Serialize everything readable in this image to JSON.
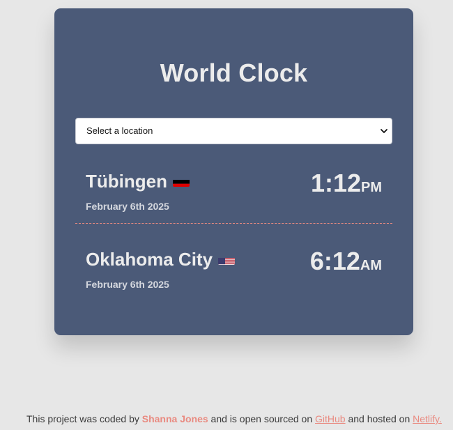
{
  "app": {
    "title": "World Clock"
  },
  "location_select": {
    "selected": "Select a location"
  },
  "cities": [
    {
      "name": "Tübingen",
      "flag_icon": "germany-flag-icon",
      "date": "February 6th 2025",
      "time": "1:12",
      "ampm": "PM"
    },
    {
      "name": "Oklahoma City",
      "flag_icon": "usa-flag-icon",
      "date": "February 6th 2025",
      "time": "6:12",
      "ampm": "AM"
    }
  ],
  "footer": {
    "text1": "This project was coded by ",
    "author": "Shanna Jones",
    "text2": " and is open sourced on ",
    "github_label": "GitHub",
    "text3": " and hosted on ",
    "netlify_label": "Netlify."
  },
  "colors": {
    "background": "#e7e7e7",
    "card": "#4b5a78",
    "text": "#ececec",
    "accent": "#e98a80"
  }
}
